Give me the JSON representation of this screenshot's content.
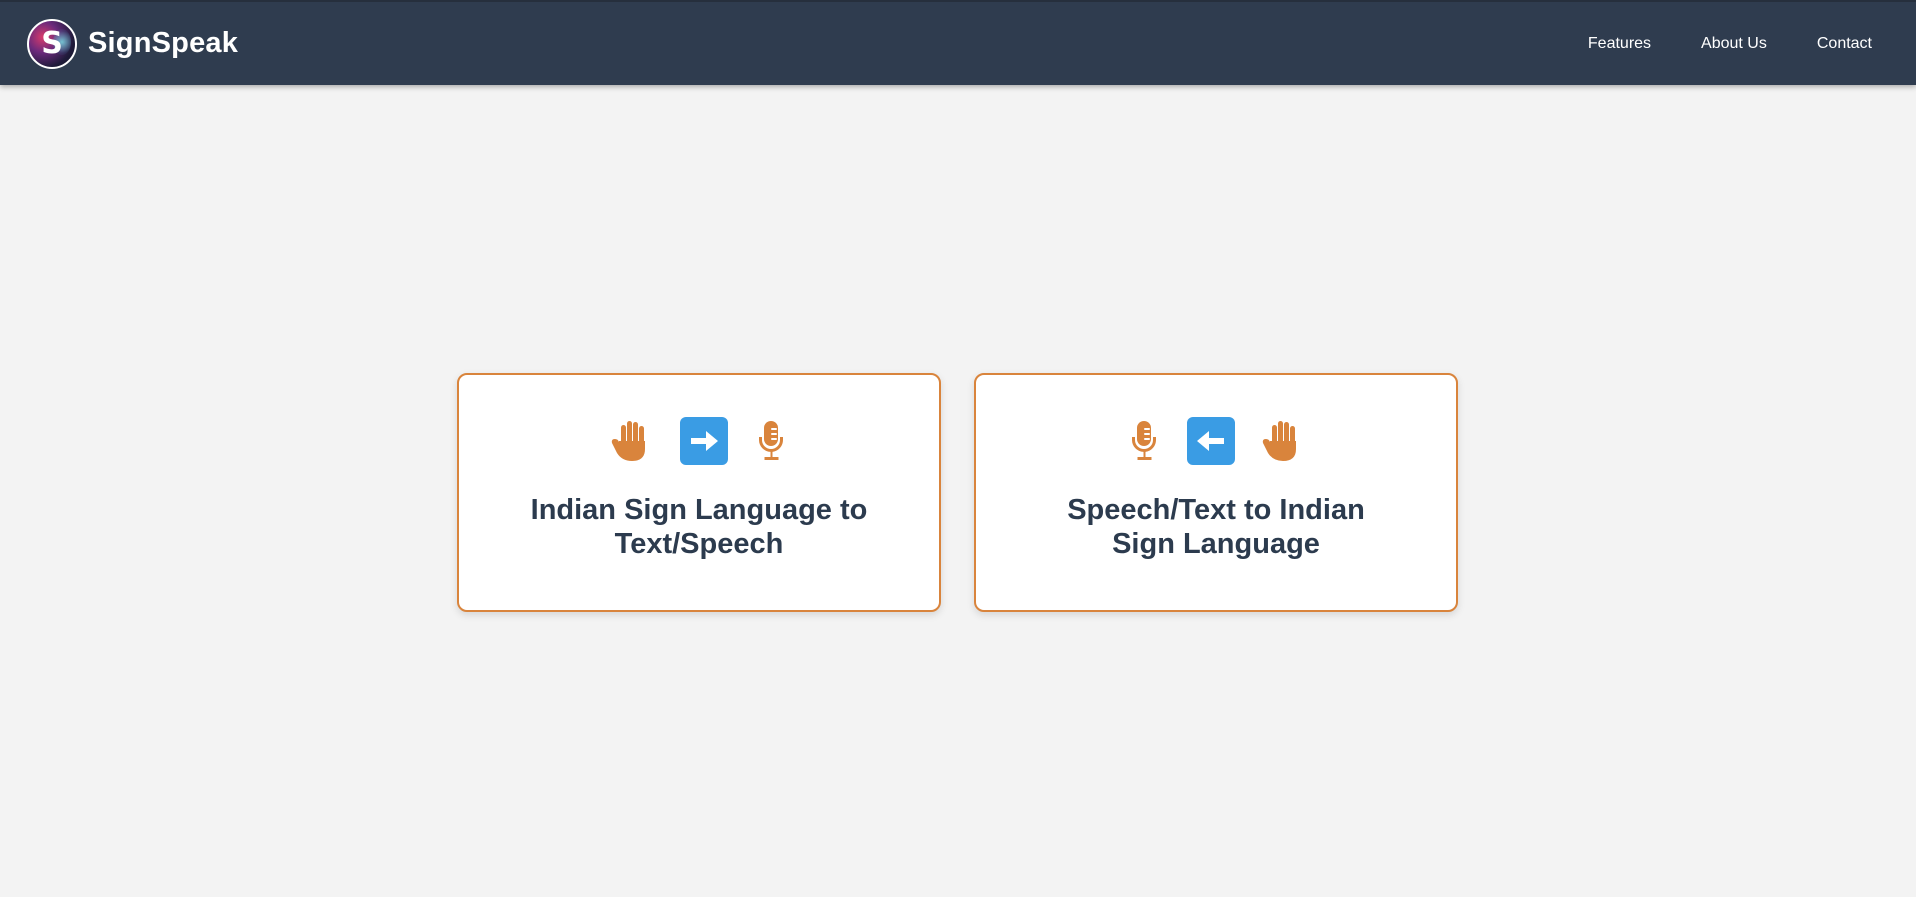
{
  "app": {
    "brand_name": "SignSpeak",
    "logo_letter": "S"
  },
  "nav": {
    "items": [
      {
        "label": "Features"
      },
      {
        "label": "About Us"
      },
      {
        "label": "Contact"
      }
    ]
  },
  "cards": [
    {
      "title": "Indian Sign Language to Text/Speech",
      "icons": [
        "hand-icon",
        "arrow-right-icon",
        "microphone-icon"
      ]
    },
    {
      "title": "Speech/Text to Indian Sign Language",
      "icons": [
        "microphone-icon",
        "arrow-left-icon",
        "hand-icon"
      ]
    }
  ],
  "colors": {
    "navbar": "#2f3c4f",
    "accent_orange": "#d9843c",
    "arrow_blue": "#3a9ce4",
    "title_text": "#2c3b4e",
    "background": "#f3f3f3"
  }
}
